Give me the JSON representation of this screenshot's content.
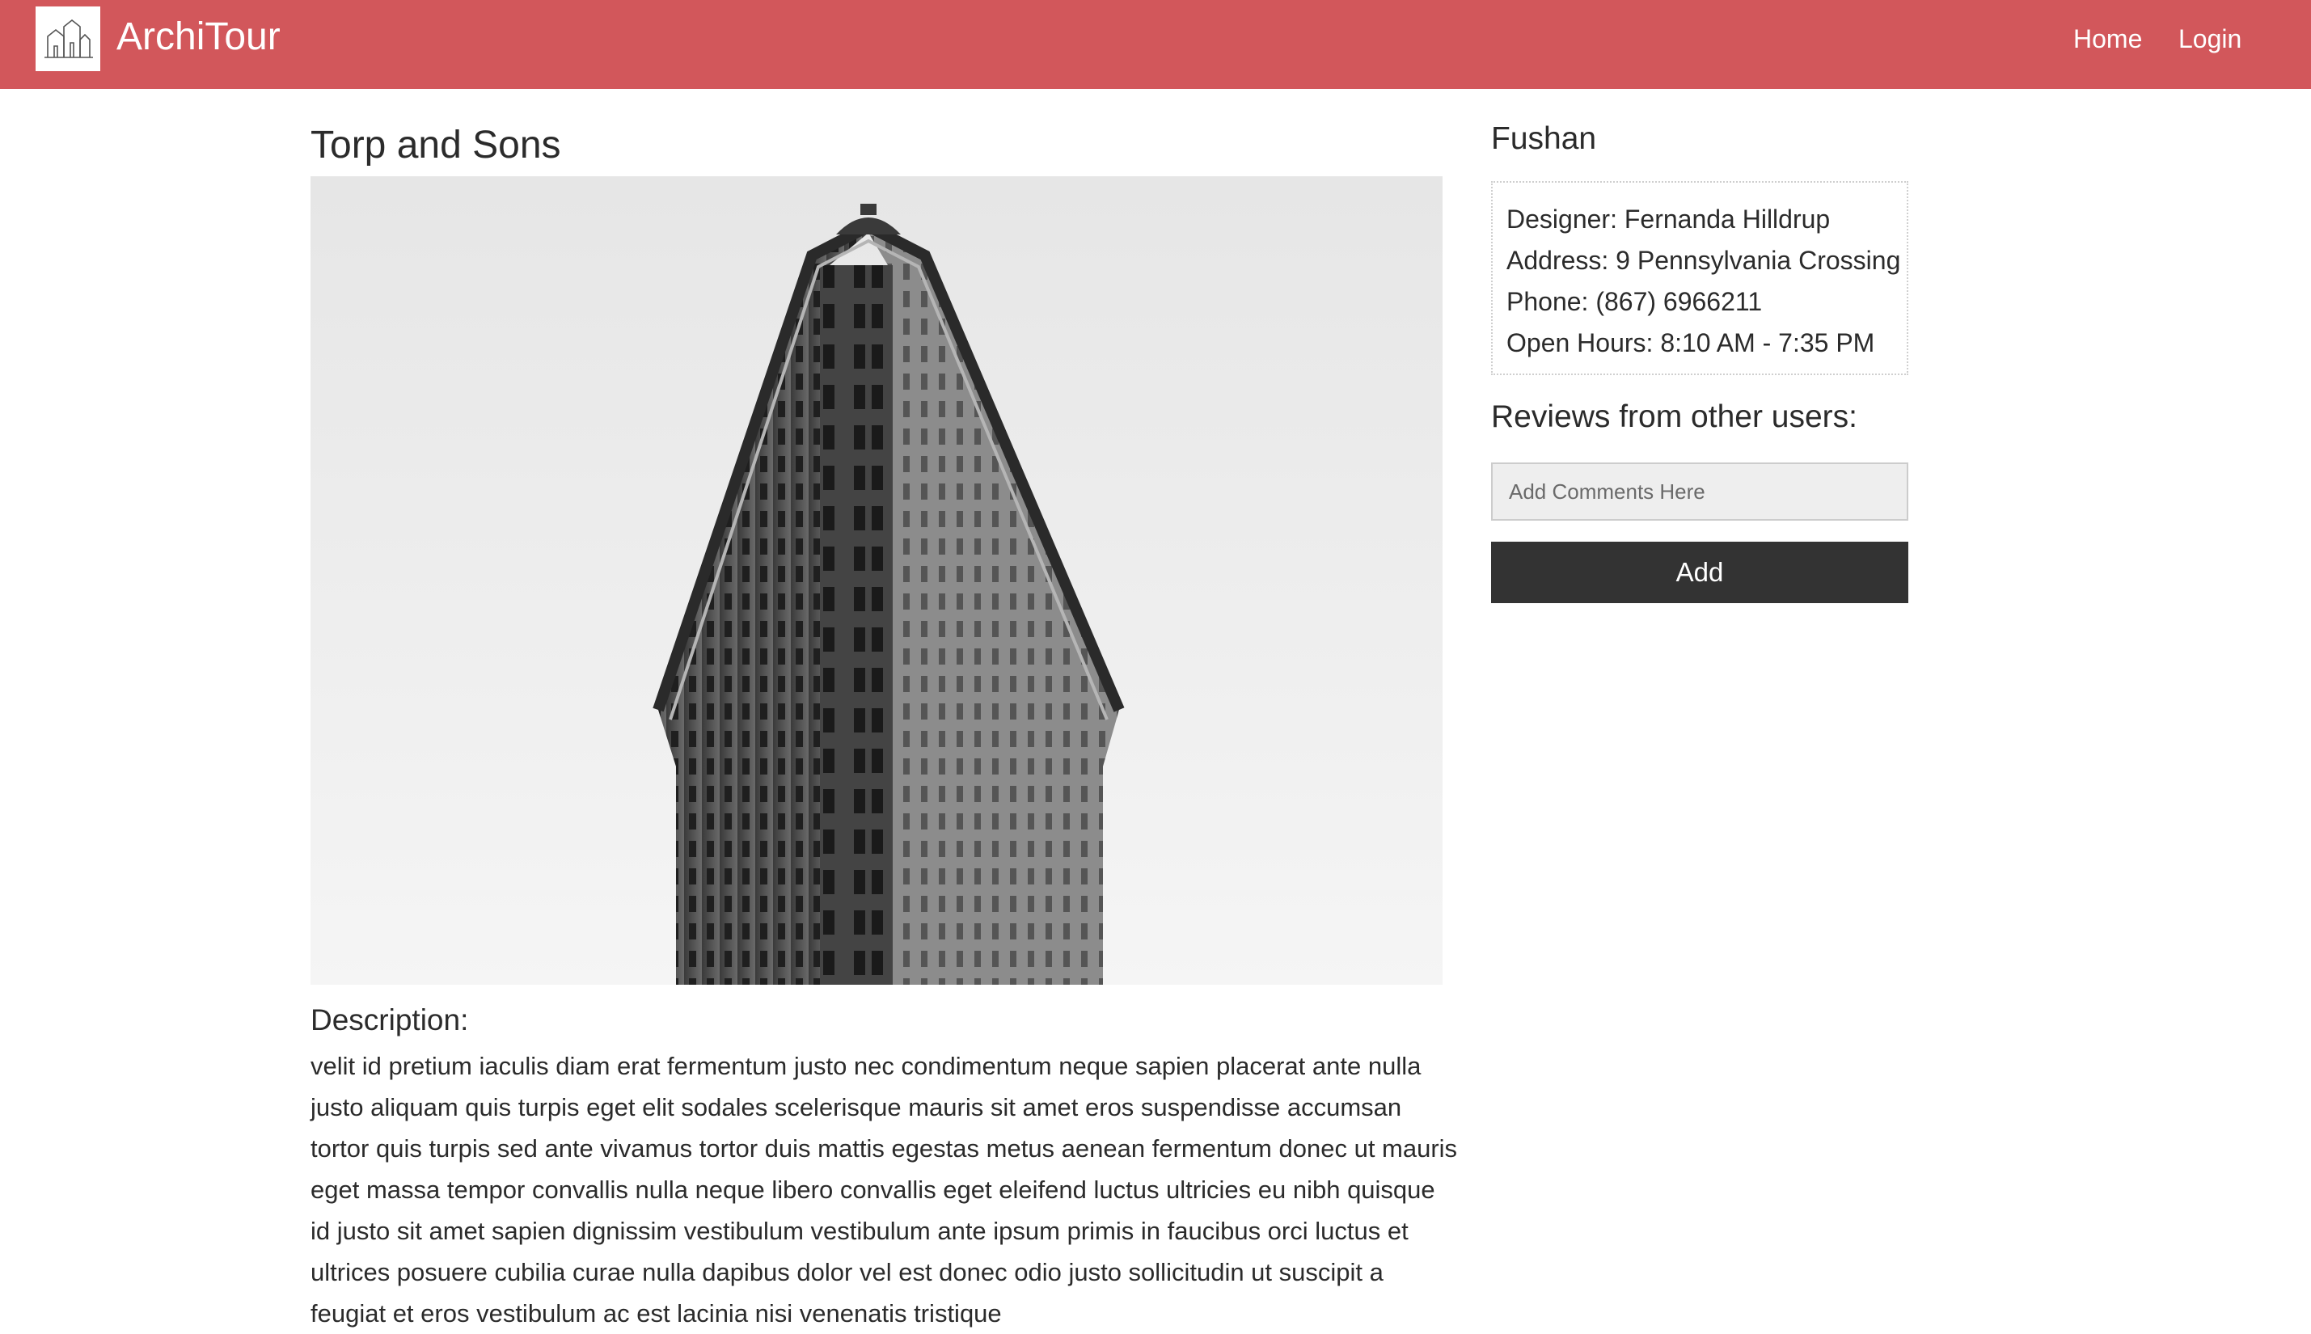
{
  "header": {
    "brand": "ArchiTour",
    "logo_icon": "buildings-logo-icon",
    "nav": [
      {
        "label": "Home"
      },
      {
        "label": "Login"
      }
    ],
    "bar_color": "#d2575b"
  },
  "main": {
    "title": "Torp and Sons",
    "image_icon": "flatiron-building-photo",
    "description_heading": "Description:",
    "description": "velit id pretium iaculis diam erat fermentum justo nec condimentum neque sapien placerat ante nulla justo aliquam quis turpis eget elit sodales scelerisque mauris sit amet eros suspendisse accumsan tortor quis turpis sed ante vivamus tortor duis mattis egestas metus aenean fermentum donec ut mauris eget massa tempor convallis nulla neque libero convallis eget eleifend luctus ultricies eu nibh quisque id justo sit amet sapien dignissim vestibulum vestibulum ante ipsum primis in faucibus orci luctus et ultrices posuere cubilia curae nulla dapibus dolor vel est donec odio justo sollicitudin ut suscipit a feugiat et eros vestibulum ac est lacinia nisi venenatis tristique"
  },
  "sidebar": {
    "title": "Fushan",
    "info": {
      "designer": "Designer: Fernanda Hilldrup",
      "address": "Address: 9 Pennsylvania Crossing",
      "phone": "Phone: (867) 6966211",
      "hours": "Open Hours: 8:10 AM - 7:35 PM"
    },
    "reviews_title": "Reviews from other users:",
    "comment_placeholder": "Add Comments Here",
    "add_label": "Add",
    "button_color": "#333333"
  }
}
